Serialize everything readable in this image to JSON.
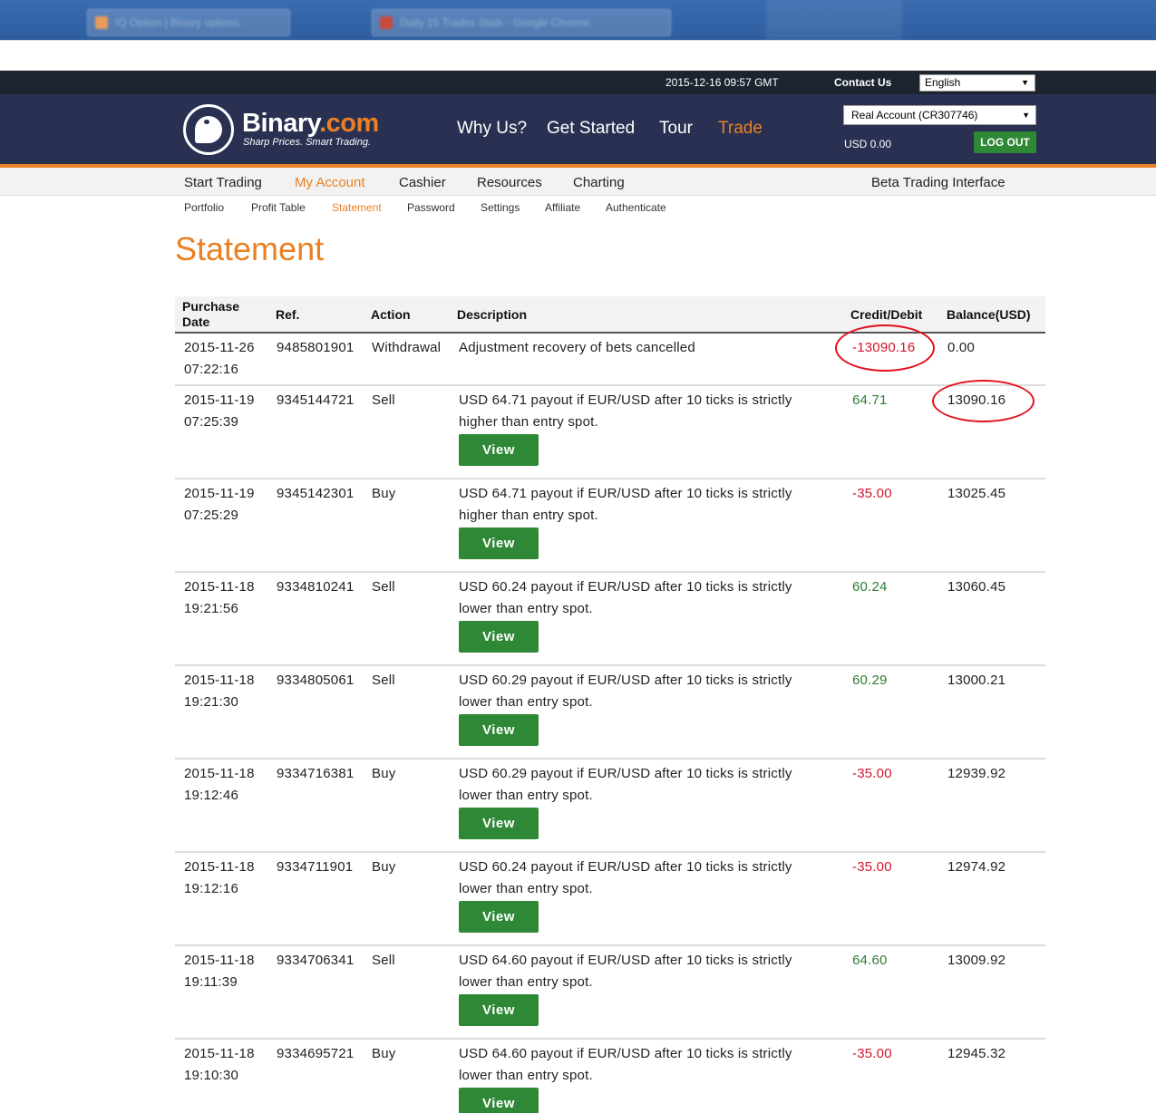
{
  "taskbar": {
    "tab1": "IQ Option | Binary options",
    "tab2": "Daily 15 Trades Stats - Google Chrome"
  },
  "topbar": {
    "datetime": "2015-12-16 09:57 GMT",
    "contact": "Contact Us",
    "language": "English"
  },
  "header": {
    "brand_main": "Binary",
    "brand_dot": ".com",
    "tagline": "Sharp Prices. Smart Trading.",
    "nav": [
      "Why Us?",
      "Get Started",
      "Tour",
      "Trade"
    ],
    "account": "Real Account (CR307746)",
    "balance": "USD 0.00",
    "logout": "LOG OUT"
  },
  "menu": {
    "items": [
      "Start Trading",
      "My Account",
      "Cashier",
      "Resources",
      "Charting"
    ],
    "beta": "Beta Trading Interface",
    "subitems": [
      "Portfolio",
      "Profit Table",
      "Statement",
      "Password",
      "Settings",
      "Affiliate",
      "Authenticate"
    ]
  },
  "page": {
    "title": "Statement"
  },
  "table": {
    "headers": {
      "date_line1": "Purchase",
      "date_line2": "Date",
      "ref": "Ref.",
      "action": "Action",
      "description": "Description",
      "credit": "Credit/Debit",
      "balance": "Balance(USD)"
    },
    "view_label": "View",
    "rows": [
      {
        "date": "2015-11-26",
        "time": "07:22:16",
        "ref": "9485801901",
        "action": "Withdrawal",
        "desc1": "Adjustment recovery of bets cancelled",
        "desc2": "",
        "credit": "-13090.16",
        "balance": "0.00"
      },
      {
        "date": "2015-11-19",
        "time": "07:25:39",
        "ref": "9345144721",
        "action": "Sell",
        "desc1": "USD 64.71 payout if EUR/USD after 10 ticks is strictly",
        "desc2": "higher than entry spot.",
        "credit": "64.71",
        "balance": "13090.16"
      },
      {
        "date": "2015-11-19",
        "time": "07:25:29",
        "ref": "9345142301",
        "action": "Buy",
        "desc1": "USD 64.71 payout if EUR/USD after 10 ticks is strictly",
        "desc2": "higher than entry spot.",
        "credit": "-35.00",
        "balance": "13025.45"
      },
      {
        "date": "2015-11-18",
        "time": "19:21:56",
        "ref": "9334810241",
        "action": "Sell",
        "desc1": "USD 60.24 payout if EUR/USD after 10 ticks is strictly",
        "desc2": "lower than entry spot.",
        "credit": "60.24",
        "balance": "13060.45"
      },
      {
        "date": "2015-11-18",
        "time": "19:21:30",
        "ref": "9334805061",
        "action": "Sell",
        "desc1": "USD 60.29 payout if EUR/USD after 10 ticks is strictly",
        "desc2": "lower than entry spot.",
        "credit": "60.29",
        "balance": "13000.21"
      },
      {
        "date": "2015-11-18",
        "time": "19:12:46",
        "ref": "9334716381",
        "action": "Buy",
        "desc1": "USD 60.29 payout if EUR/USD after 10 ticks is strictly",
        "desc2": "lower than entry spot.",
        "credit": "-35.00",
        "balance": "12939.92"
      },
      {
        "date": "2015-11-18",
        "time": "19:12:16",
        "ref": "9334711901",
        "action": "Buy",
        "desc1": "USD 60.24 payout if EUR/USD after 10 ticks is strictly",
        "desc2": "lower than entry spot.",
        "credit": "-35.00",
        "balance": "12974.92"
      },
      {
        "date": "2015-11-18",
        "time": "19:11:39",
        "ref": "9334706341",
        "action": "Sell",
        "desc1": "USD 64.60 payout if EUR/USD after 10 ticks is strictly",
        "desc2": "lower than entry spot.",
        "credit": "64.60",
        "balance": "13009.92"
      },
      {
        "date": "2015-11-18",
        "time": "19:10:30",
        "ref": "9334695721",
        "action": "Buy",
        "desc1": "USD 64.60 payout if EUR/USD after 10 ticks is strictly",
        "desc2": "lower than entry spot.",
        "credit": "-35.00",
        "balance": "12945.32"
      }
    ]
  },
  "colors": {
    "accent": "#e98024",
    "header_bg": "#2a3052",
    "positive": "#2e7d32",
    "negative": "#d2162d",
    "button": "#2e8836",
    "annotation": "#e3101e"
  }
}
